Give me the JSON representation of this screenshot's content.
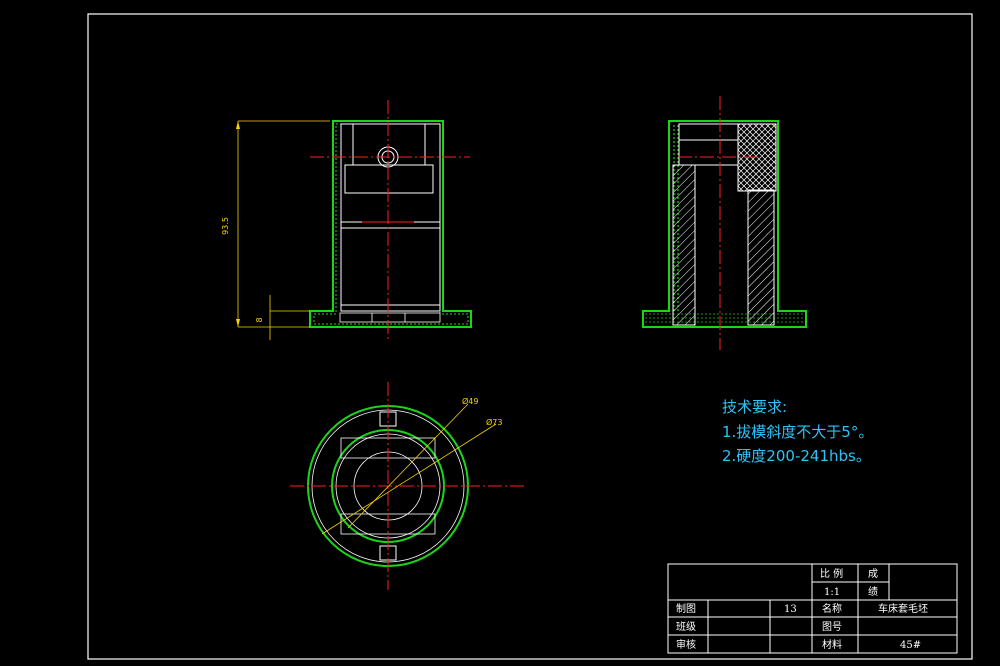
{
  "colors": {
    "background": "#000000",
    "frame": "#ffffff",
    "outline_green": "#19d619",
    "centerline_red": "#ff2020",
    "dimension_yellow": "#f5d400",
    "requirements_blue": "#2fc3f5"
  },
  "dimensions": {
    "height": "93.5",
    "base": "8",
    "inner_diameter": "Ø49",
    "outer_diameter": "Ø73"
  },
  "requirements": {
    "title": "技术要求:",
    "item1": "1.拔模斜度不大于5°。",
    "item2": "2.硬度200-241hbs。"
  },
  "title_block": {
    "scale_label": "比 例",
    "scale_value": "1:1",
    "result_label_1": "成",
    "result_label_2": "绩",
    "drawn_by_label": "制图",
    "drawn_by_value": "13",
    "name_label": "名称",
    "name_value": "车床套毛坯",
    "class_label": "班级",
    "drawing_no_label": "图号",
    "reviewed_label": "审核",
    "material_label": "材料",
    "material_value": "45#"
  }
}
